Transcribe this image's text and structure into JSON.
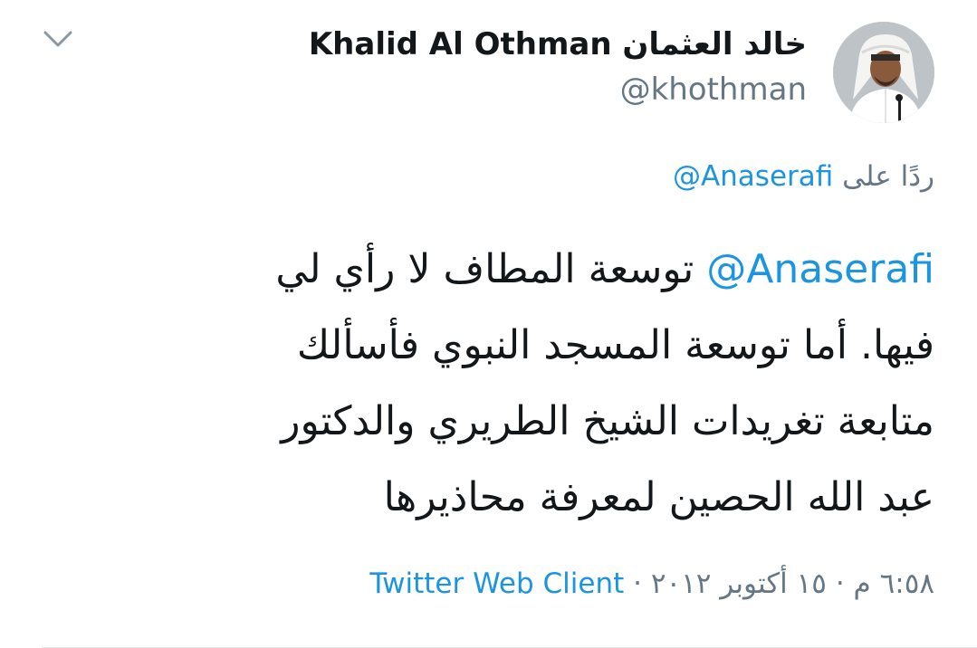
{
  "header": {
    "display_name_latin": "Khalid Al Othman",
    "display_name_arabic": "خالد العثمان",
    "handle": "@khothman",
    "avatar_icon": "user-photo-icon"
  },
  "reply": {
    "prefix": "ردًا على",
    "mention": "@Anaserafi"
  },
  "tweet": {
    "mention": "@Anaserafi",
    "line1_text": " توسعة المطاف لا رأي لي",
    "line2": "فيها. أما توسعة المسجد النبوي فأسألك",
    "line3": "متابعة تغريدات الشيخ الطريري والدكتور",
    "line4": "عبد الله الحصين لمعرفة محاذيرها"
  },
  "meta": {
    "time": "٦:٥٨ م",
    "separator": "·",
    "date": "١٥ أكتوبر ٢٠١٢",
    "source": "Twitter Web Client"
  },
  "colors": {
    "link": "#1b95e0",
    "secondary_text": "#657786",
    "primary_text": "#14171a",
    "divider": "#e6ecf0"
  },
  "icons": {
    "chevron": "chevron-down-icon"
  }
}
